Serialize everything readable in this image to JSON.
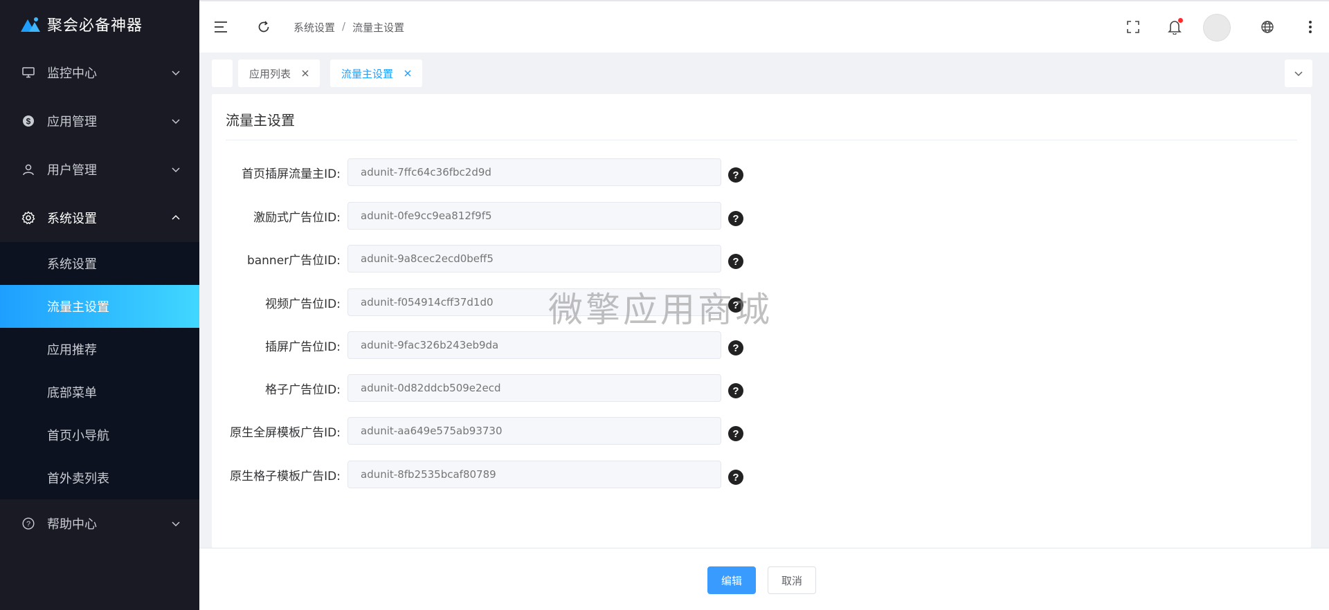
{
  "app": {
    "name": "聚会必备神器"
  },
  "sidebar": {
    "items": [
      {
        "label": "监控中心",
        "icon": "monitor-icon"
      },
      {
        "label": "应用管理",
        "icon": "dollar-circle-icon"
      },
      {
        "label": "用户管理",
        "icon": "user-icon"
      },
      {
        "label": "系统设置",
        "icon": "gear-icon"
      },
      {
        "label": "帮助中心",
        "icon": "question-circle-icon"
      }
    ],
    "submenu": [
      {
        "label": "系统设置"
      },
      {
        "label": "流量主设置"
      },
      {
        "label": "应用推荐"
      },
      {
        "label": "底部菜单"
      },
      {
        "label": "首页小导航"
      },
      {
        "label": "首外卖列表"
      }
    ],
    "active_sub": "流量主设置",
    "active_color": "#1e9fff"
  },
  "header": {
    "breadcrumb": [
      "系统设置",
      "/",
      "流量主设置"
    ]
  },
  "tabs": [
    {
      "label": "应用列表",
      "active": false
    },
    {
      "label": "流量主设置",
      "active": true
    }
  ],
  "card": {
    "title": "流量主设置",
    "fields": [
      {
        "label": "首页插屏流量主ID:",
        "placeholder": "adunit-7ffc64c36fbc2d9d"
      },
      {
        "label": "激励式广告位ID:",
        "placeholder": "adunit-0fe9cc9ea812f9f5"
      },
      {
        "label": "banner广告位ID:",
        "placeholder": "adunit-9a8cec2ecd0beff5"
      },
      {
        "label": "视频广告位ID:",
        "placeholder": "adunit-f054914cff37d1d0"
      },
      {
        "label": "插屏广告位ID:",
        "placeholder": "adunit-9fac326b243eb9da"
      },
      {
        "label": "格子广告位ID:",
        "placeholder": "adunit-0d82ddcb509e2ecd"
      },
      {
        "label": "原生全屏模板广告ID:",
        "placeholder": "adunit-aa649e575ab93730"
      },
      {
        "label": "原生格子模板广告ID:",
        "placeholder": "adunit-8fb2535bcaf80789"
      }
    ],
    "help_glyph": "?"
  },
  "watermark": "微擎应用商城",
  "footer": {
    "edit_label": "编辑",
    "cancel_label": "取消"
  },
  "colors": {
    "sidebar_bg": "#191a23",
    "primary": "#3a9bff"
  }
}
